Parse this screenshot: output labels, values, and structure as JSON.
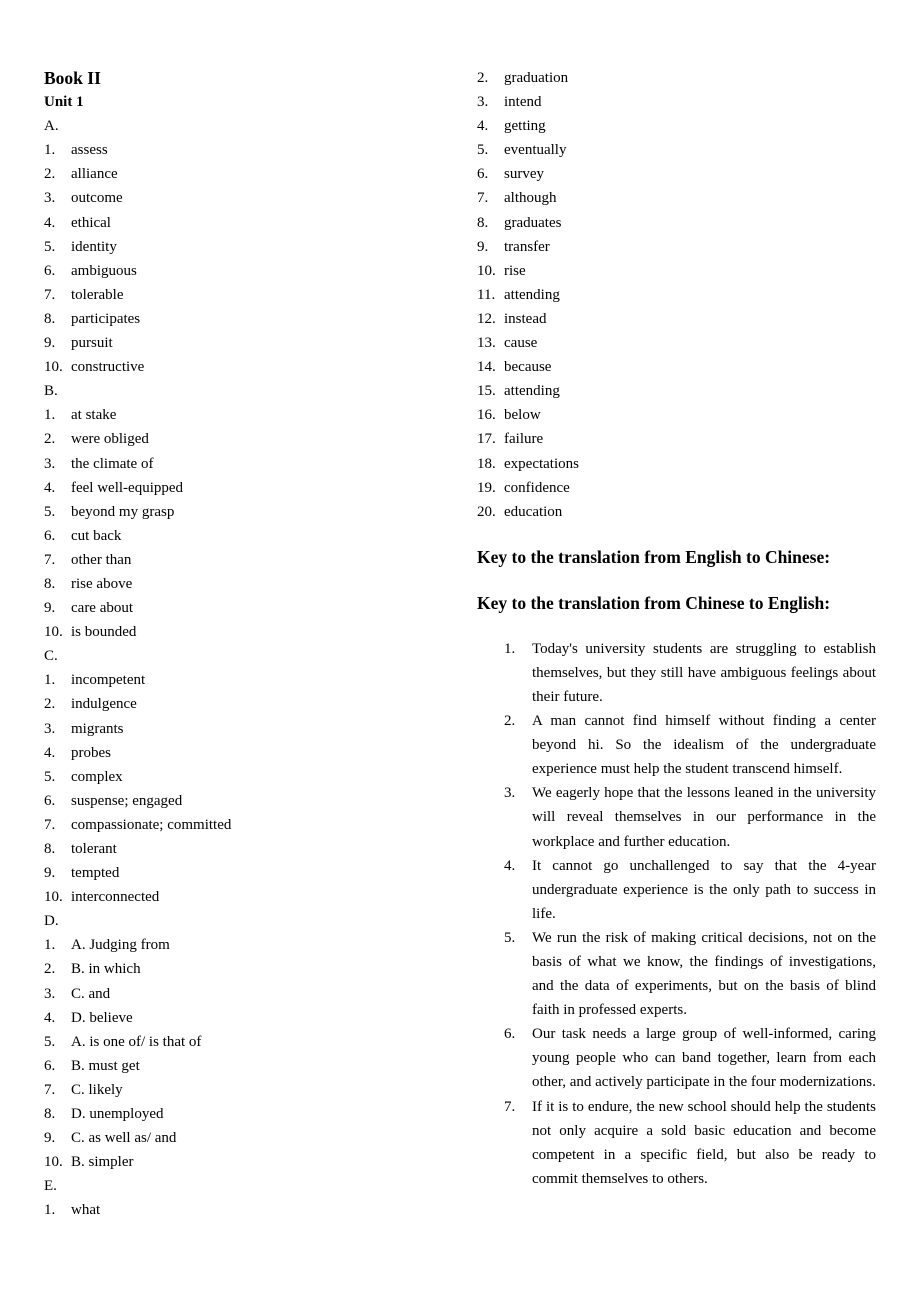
{
  "left_column": {
    "book_title": "Book II",
    "unit_title": "Unit 1",
    "sections": [
      {
        "label": "A.",
        "items": [
          {
            "num": "1.",
            "text": "assess"
          },
          {
            "num": "2.",
            "text": "alliance"
          },
          {
            "num": "3.",
            "text": "outcome"
          },
          {
            "num": "4.",
            "text": "ethical"
          },
          {
            "num": "5.",
            "text": "identity"
          },
          {
            "num": "6.",
            "text": "ambiguous"
          },
          {
            "num": "7.",
            "text": "tolerable"
          },
          {
            "num": "8.",
            "text": "participates"
          },
          {
            "num": "9.",
            "text": "pursuit"
          },
          {
            "num": "10.",
            "text": "constructive"
          }
        ]
      },
      {
        "label": "B.",
        "items": [
          {
            "num": "1.",
            "text": "at stake"
          },
          {
            "num": "2.",
            "text": "were obliged"
          },
          {
            "num": "3.",
            "text": "the climate of"
          },
          {
            "num": "4.",
            "text": "feel well-equipped"
          },
          {
            "num": "5.",
            "text": "beyond my grasp"
          },
          {
            "num": "6.",
            "text": "cut back"
          },
          {
            "num": "7.",
            "text": "other than"
          },
          {
            "num": "8.",
            "text": "rise above"
          },
          {
            "num": "9.",
            "text": "care about"
          },
          {
            "num": "10.",
            "text": "is bounded"
          }
        ]
      },
      {
        "label": "C.",
        "items": [
          {
            "num": "1.",
            "text": "incompetent"
          },
          {
            "num": "2.",
            "text": "indulgence"
          },
          {
            "num": "3.",
            "text": "migrants"
          },
          {
            "num": "4.",
            "text": "probes"
          },
          {
            "num": "5.",
            "text": "complex"
          },
          {
            "num": "6.",
            "text": "suspense; engaged"
          },
          {
            "num": "7.",
            "text": "compassionate; committed"
          },
          {
            "num": "8.",
            "text": "tolerant"
          },
          {
            "num": "9.",
            "text": "tempted"
          },
          {
            "num": "10.",
            "text": "interconnected"
          }
        ]
      },
      {
        "label": "D.",
        "items": [
          {
            "num": "1.",
            "text": "A. Judging from"
          },
          {
            "num": "2.",
            "text": "B. in which"
          },
          {
            "num": "3.",
            "text": "C. and"
          },
          {
            "num": "4.",
            "text": "D. believe"
          },
          {
            "num": "5.",
            "text": "A. is one of/ is that of"
          },
          {
            "num": "6.",
            "text": "B. must get"
          },
          {
            "num": "7.",
            "text": "C. likely"
          },
          {
            "num": "8.",
            "text": "D. unemployed"
          },
          {
            "num": "9.",
            "text": "C. as well as/ and"
          },
          {
            "num": "10.",
            "text": "B. simpler"
          }
        ]
      },
      {
        "label": "E.",
        "items": [
          {
            "num": "1.",
            "text": "what"
          }
        ]
      }
    ]
  },
  "right_column": {
    "e_continued": [
      {
        "num": "2.",
        "text": "graduation"
      },
      {
        "num": "3.",
        "text": "intend"
      },
      {
        "num": "4.",
        "text": "getting"
      },
      {
        "num": "5.",
        "text": "eventually"
      },
      {
        "num": "6.",
        "text": "survey"
      },
      {
        "num": "7.",
        "text": "although"
      },
      {
        "num": "8.",
        "text": "graduates"
      },
      {
        "num": "9.",
        "text": "transfer"
      },
      {
        "num": "10.",
        "text": "rise"
      },
      {
        "num": "11.",
        "text": "attending"
      },
      {
        "num": "12.",
        "text": "instead"
      },
      {
        "num": "13.",
        "text": "cause"
      },
      {
        "num": "14.",
        "text": "because"
      },
      {
        "num": "15.",
        "text": "attending"
      },
      {
        "num": "16.",
        "text": "below"
      },
      {
        "num": "17.",
        "text": "failure"
      },
      {
        "num": "18.",
        "text": "expectations"
      },
      {
        "num": "19.",
        "text": "confidence"
      },
      {
        "num": "20.",
        "text": "education"
      }
    ],
    "heading_en_to_cn": "Key to the translation from English to Chinese:",
    "heading_cn_to_en": "Key to the translation from Chinese to English:",
    "translations": [
      {
        "num": "1.",
        "text": "Today's university students are struggling to establish themselves, but they still have ambiguous feelings about their future."
      },
      {
        "num": "2.",
        "text": "A man cannot find himself without finding a center beyond hi. So the idealism of the undergraduate experience must help the student transcend himself."
      },
      {
        "num": "3.",
        "text": "We eagerly hope that the lessons leaned in the university will reveal themselves in our performance in the workplace and further education."
      },
      {
        "num": "4.",
        "text": "It cannot go unchallenged to say that the 4-year undergraduate experience is the only path to success in life."
      },
      {
        "num": "5.",
        "text": "We run the risk of making critical decisions, not on the basis of what we know, the findings of investigations, and the data of experiments, but on the basis of blind faith in professed experts."
      },
      {
        "num": "6.",
        "text": "Our task needs a large group of well-informed, caring young people who can band together, learn from each other, and actively participate in the four modernizations."
      },
      {
        "num": "7.",
        "text": "If it is to endure, the new school should help the students not only acquire a sold basic education and become competent in a specific field, but also be ready to commit themselves to others."
      }
    ]
  }
}
